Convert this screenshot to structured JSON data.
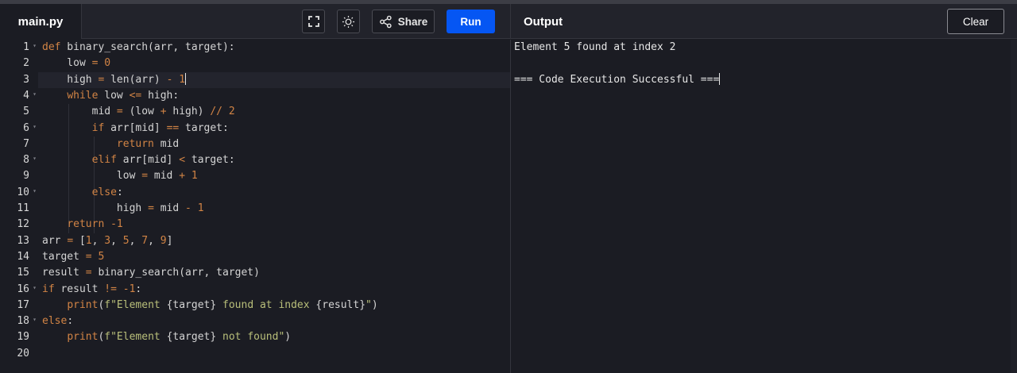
{
  "header": {
    "file_tab": "main.py",
    "share_label": "Share",
    "run_label": "Run",
    "output_title": "Output",
    "clear_label": "Clear"
  },
  "icons": {
    "fullscreen": "fullscreen-icon",
    "theme": "sun-icon",
    "share": "share-icon"
  },
  "colors": {
    "run_button": "#0556f3",
    "keyword": "#d28445",
    "string": "#b9bf7a"
  },
  "editor": {
    "language": "python",
    "active_line": 3,
    "folded_lines": [
      1,
      4,
      6,
      8,
      10,
      16,
      18
    ],
    "lines": [
      {
        "n": "1",
        "tokens": [
          {
            "t": "def",
            "c": "kw"
          },
          {
            "t": " binary_search(arr, target):"
          }
        ]
      },
      {
        "n": "2",
        "tokens": [
          {
            "t": "    low "
          },
          {
            "t": "=",
            "c": "op"
          },
          {
            "t": " "
          },
          {
            "t": "0",
            "c": "num"
          }
        ]
      },
      {
        "n": "3",
        "tokens": [
          {
            "t": "    high "
          },
          {
            "t": "=",
            "c": "op"
          },
          {
            "t": " len(arr) "
          },
          {
            "t": "-",
            "c": "op"
          },
          {
            "t": " "
          },
          {
            "t": "1",
            "c": "num"
          }
        ]
      },
      {
        "n": "4",
        "tokens": [
          {
            "t": "    "
          },
          {
            "t": "while",
            "c": "kw"
          },
          {
            "t": " low "
          },
          {
            "t": "<=",
            "c": "op"
          },
          {
            "t": " high:"
          }
        ]
      },
      {
        "n": "5",
        "tokens": [
          {
            "t": "        mid "
          },
          {
            "t": "=",
            "c": "op"
          },
          {
            "t": " (low "
          },
          {
            "t": "+",
            "c": "op"
          },
          {
            "t": " high) "
          },
          {
            "t": "//",
            "c": "op"
          },
          {
            "t": " "
          },
          {
            "t": "2",
            "c": "num"
          }
        ]
      },
      {
        "n": "6",
        "tokens": [
          {
            "t": "        "
          },
          {
            "t": "if",
            "c": "kw"
          },
          {
            "t": " arr[mid] "
          },
          {
            "t": "==",
            "c": "op"
          },
          {
            "t": " target:"
          }
        ]
      },
      {
        "n": "7",
        "tokens": [
          {
            "t": "            "
          },
          {
            "t": "return",
            "c": "kw"
          },
          {
            "t": " mid"
          }
        ]
      },
      {
        "n": "8",
        "tokens": [
          {
            "t": "        "
          },
          {
            "t": "elif",
            "c": "kw"
          },
          {
            "t": " arr[mid] "
          },
          {
            "t": "<",
            "c": "op"
          },
          {
            "t": " target:"
          }
        ]
      },
      {
        "n": "9",
        "tokens": [
          {
            "t": "            low "
          },
          {
            "t": "=",
            "c": "op"
          },
          {
            "t": " mid "
          },
          {
            "t": "+",
            "c": "op"
          },
          {
            "t": " "
          },
          {
            "t": "1",
            "c": "num"
          }
        ]
      },
      {
        "n": "10",
        "tokens": [
          {
            "t": "        "
          },
          {
            "t": "else",
            "c": "kw"
          },
          {
            "t": ":"
          }
        ]
      },
      {
        "n": "11",
        "tokens": [
          {
            "t": "            high "
          },
          {
            "t": "=",
            "c": "op"
          },
          {
            "t": " mid "
          },
          {
            "t": "-",
            "c": "op"
          },
          {
            "t": " "
          },
          {
            "t": "1",
            "c": "num"
          }
        ]
      },
      {
        "n": "12",
        "tokens": [
          {
            "t": "    "
          },
          {
            "t": "return",
            "c": "kw"
          },
          {
            "t": " "
          },
          {
            "t": "-1",
            "c": "num"
          }
        ]
      },
      {
        "n": "13",
        "tokens": [
          {
            "t": "arr "
          },
          {
            "t": "=",
            "c": "op"
          },
          {
            "t": " ["
          },
          {
            "t": "1",
            "c": "num"
          },
          {
            "t": ", "
          },
          {
            "t": "3",
            "c": "num"
          },
          {
            "t": ", "
          },
          {
            "t": "5",
            "c": "num"
          },
          {
            "t": ", "
          },
          {
            "t": "7",
            "c": "num"
          },
          {
            "t": ", "
          },
          {
            "t": "9",
            "c": "num"
          },
          {
            "t": "]"
          }
        ]
      },
      {
        "n": "14",
        "tokens": [
          {
            "t": "target "
          },
          {
            "t": "=",
            "c": "op"
          },
          {
            "t": " "
          },
          {
            "t": "5",
            "c": "num"
          }
        ]
      },
      {
        "n": "15",
        "tokens": [
          {
            "t": "result "
          },
          {
            "t": "=",
            "c": "op"
          },
          {
            "t": " binary_search(arr, target)"
          }
        ]
      },
      {
        "n": "16",
        "tokens": [
          {
            "t": "if",
            "c": "kw"
          },
          {
            "t": " result "
          },
          {
            "t": "!=",
            "c": "op"
          },
          {
            "t": " "
          },
          {
            "t": "-1",
            "c": "num"
          },
          {
            "t": ":"
          }
        ]
      },
      {
        "n": "17",
        "tokens": [
          {
            "t": "    "
          },
          {
            "t": "print",
            "c": "kw"
          },
          {
            "t": "("
          },
          {
            "t": "f\"Element ",
            "c": "str"
          },
          {
            "t": "{target}"
          },
          {
            "t": " found at index ",
            "c": "str"
          },
          {
            "t": "{result}"
          },
          {
            "t": "\"",
            "c": "str"
          },
          {
            "t": ")"
          }
        ]
      },
      {
        "n": "18",
        "tokens": [
          {
            "t": "else",
            "c": "kw"
          },
          {
            "t": ":"
          }
        ]
      },
      {
        "n": "19",
        "tokens": [
          {
            "t": "    "
          },
          {
            "t": "print",
            "c": "kw"
          },
          {
            "t": "("
          },
          {
            "t": "f\"Element ",
            "c": "str"
          },
          {
            "t": "{target}"
          },
          {
            "t": " not found",
            "c": "str"
          },
          {
            "t": "\"",
            "c": "str"
          },
          {
            "t": ")"
          }
        ]
      },
      {
        "n": "20",
        "tokens": []
      }
    ]
  },
  "output": {
    "lines": [
      "Element 5 found at index 2",
      "",
      "=== Code Execution Successful ==="
    ]
  }
}
